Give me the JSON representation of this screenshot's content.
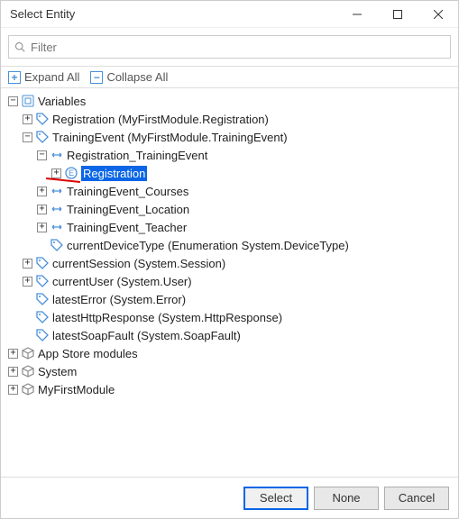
{
  "window": {
    "title": "Select Entity"
  },
  "filter": {
    "placeholder": "Filter"
  },
  "toolbar": {
    "expand": "Expand All",
    "collapse": "Collapse All"
  },
  "tree": {
    "n0": {
      "label": "Variables"
    },
    "n1": {
      "label": "Registration (MyFirstModule.Registration)"
    },
    "n2": {
      "label": "TrainingEvent (MyFirstModule.TrainingEvent)"
    },
    "n3": {
      "label": "Registration_TrainingEvent"
    },
    "n4": {
      "label": "Registration"
    },
    "n5": {
      "label": "TrainingEvent_Courses"
    },
    "n6": {
      "label": "TrainingEvent_Location"
    },
    "n7": {
      "label": "TrainingEvent_Teacher"
    },
    "n8": {
      "label": "currentDeviceType (Enumeration System.DeviceType)"
    },
    "n9": {
      "label": "currentSession (System.Session)"
    },
    "n10": {
      "label": "currentUser (System.User)"
    },
    "n11": {
      "label": "latestError (System.Error)"
    },
    "n12": {
      "label": "latestHttpResponse (System.HttpResponse)"
    },
    "n13": {
      "label": "latestSoapFault (System.SoapFault)"
    },
    "n14": {
      "label": "App Store modules"
    },
    "n15": {
      "label": "System"
    },
    "n16": {
      "label": "MyFirstModule"
    }
  },
  "footer": {
    "select": "Select",
    "none": "None",
    "cancel": "Cancel"
  }
}
